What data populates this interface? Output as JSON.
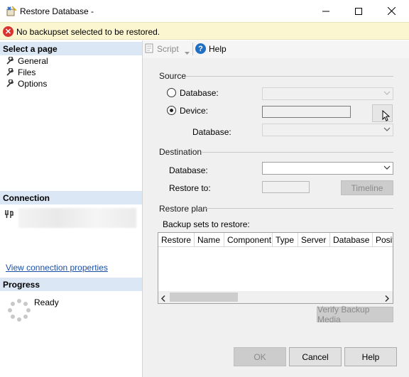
{
  "window": {
    "title": "Restore Database -",
    "minimize_icon": "minimize-icon",
    "maximize_icon": "maximize-icon",
    "close_icon": "close-icon"
  },
  "banner": {
    "message": "No backupset selected to be restored.",
    "icon": "error-icon",
    "color": "#d9322f"
  },
  "left": {
    "select_page_header": "Select a page",
    "pages": [
      {
        "label": "General"
      },
      {
        "label": "Files"
      },
      {
        "label": "Options"
      }
    ],
    "connection_header": "Connection",
    "view_connection_link": "View connection properties",
    "progress_header": "Progress",
    "progress_status": "Ready"
  },
  "toolbar": {
    "script_label": "Script",
    "help_label": "Help"
  },
  "source": {
    "title": "Source",
    "database_radio_label": "Database:",
    "device_radio_label": "Device:",
    "database_label": "Database:",
    "selected_option": "Device"
  },
  "destination": {
    "title": "Destination",
    "database_label": "Database:",
    "restore_to_label": "Restore to:",
    "timeline_button": "Timeline"
  },
  "restore_plan": {
    "title": "Restore plan",
    "backup_sets_label": "Backup sets to restore:",
    "columns": [
      "Restore",
      "Name",
      "Component",
      "Type",
      "Server",
      "Database",
      "Posit"
    ],
    "verify_button": "Verify Backup Media"
  },
  "footer": {
    "ok": "OK",
    "cancel": "Cancel",
    "help": "Help"
  },
  "colors": {
    "section_header_bg": "#dbe7f5",
    "banner_bg": "#fbf6cf",
    "link": "#1a4fa8",
    "help_icon": "#1f6fc5"
  }
}
